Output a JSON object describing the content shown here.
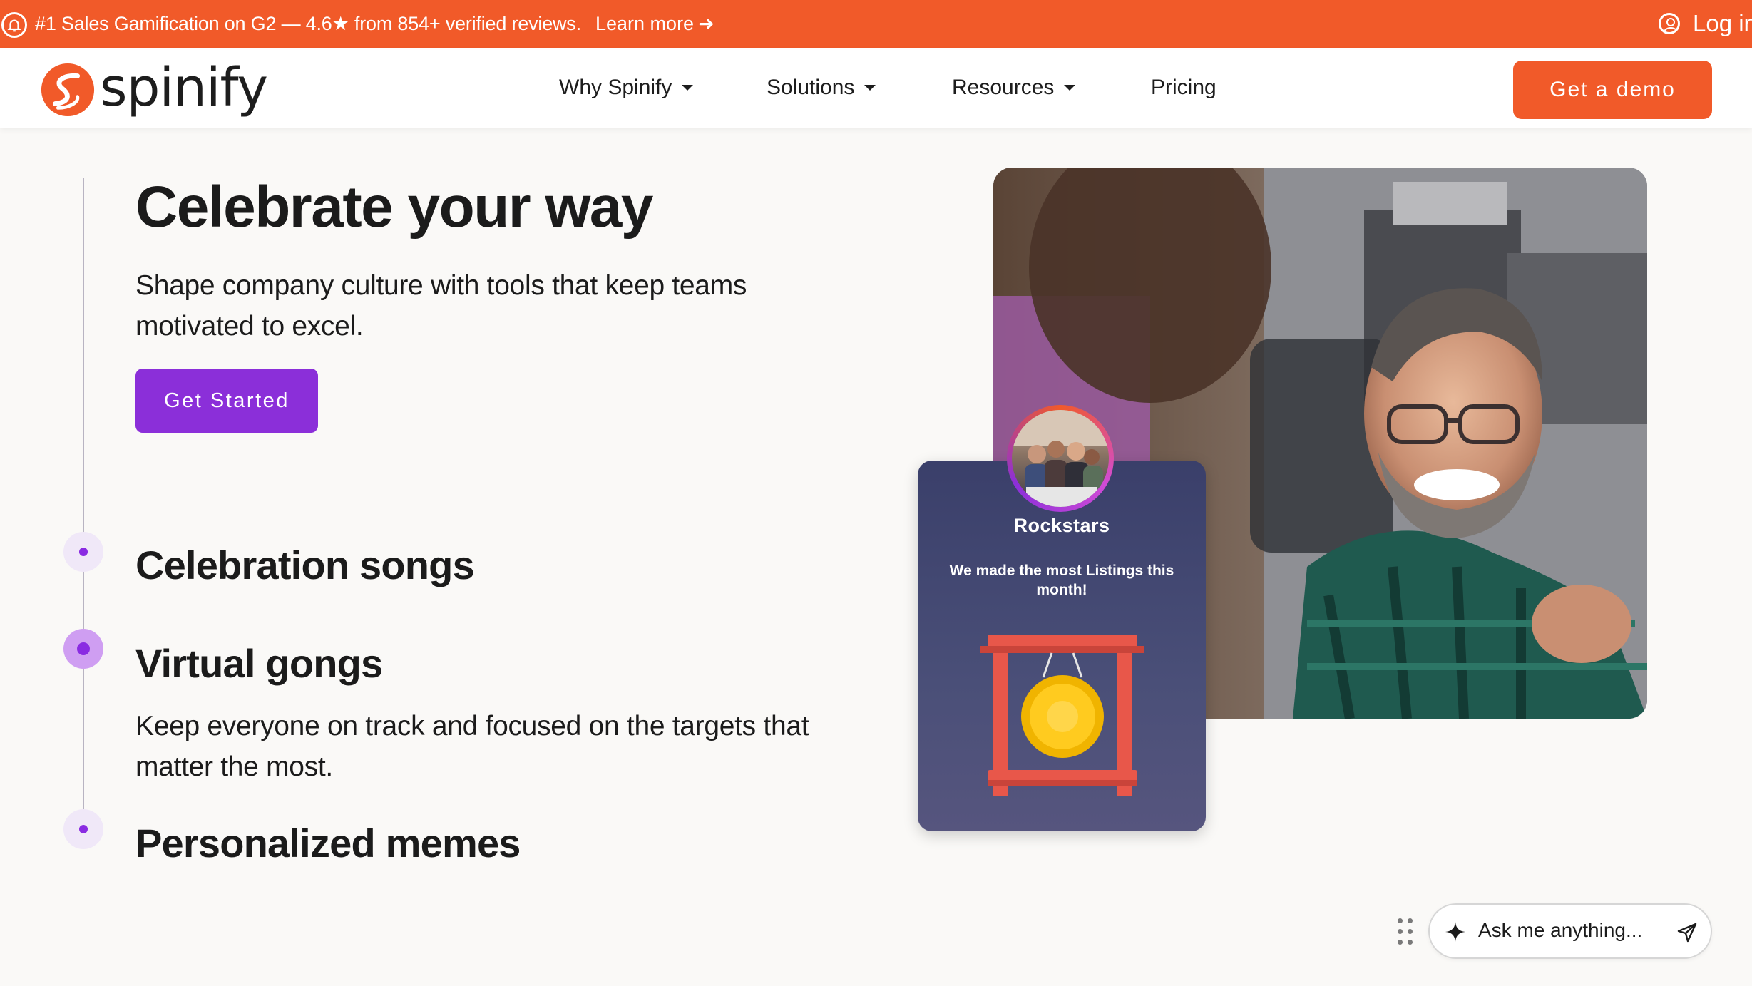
{
  "announcement": {
    "message": "#1 Sales Gamification on G2 — 4.6★ from 854+ verified reviews.",
    "learn_more": "Learn more",
    "learn_more_arrow": "➜",
    "login": "Log in"
  },
  "nav": {
    "logo_text": "spinify",
    "items": [
      {
        "label": "Why Spinify",
        "dropdown": true
      },
      {
        "label": "Solutions",
        "dropdown": true
      },
      {
        "label": "Resources",
        "dropdown": true
      },
      {
        "label": "Pricing",
        "dropdown": false
      }
    ],
    "cta": "Get a demo"
  },
  "hero": {
    "title": "Celebrate your way",
    "subtitle": "Shape company culture with tools that keep teams motivated to excel.",
    "cta": "Get Started"
  },
  "features": [
    {
      "title": "Celebration songs",
      "active": false
    },
    {
      "title": "Virtual gongs",
      "active": true,
      "description": "Keep everyone on track and focused on the targets that matter the most."
    },
    {
      "title": "Personalized memes",
      "active": false
    }
  ],
  "card": {
    "team_name": "Rockstars",
    "message": "We made the most Listings this month!"
  },
  "chat": {
    "placeholder": "Ask me anything..."
  },
  "colors": {
    "brand_orange": "#f15a29",
    "brand_purple": "#8b2fd9",
    "background": "#faf9f7"
  }
}
